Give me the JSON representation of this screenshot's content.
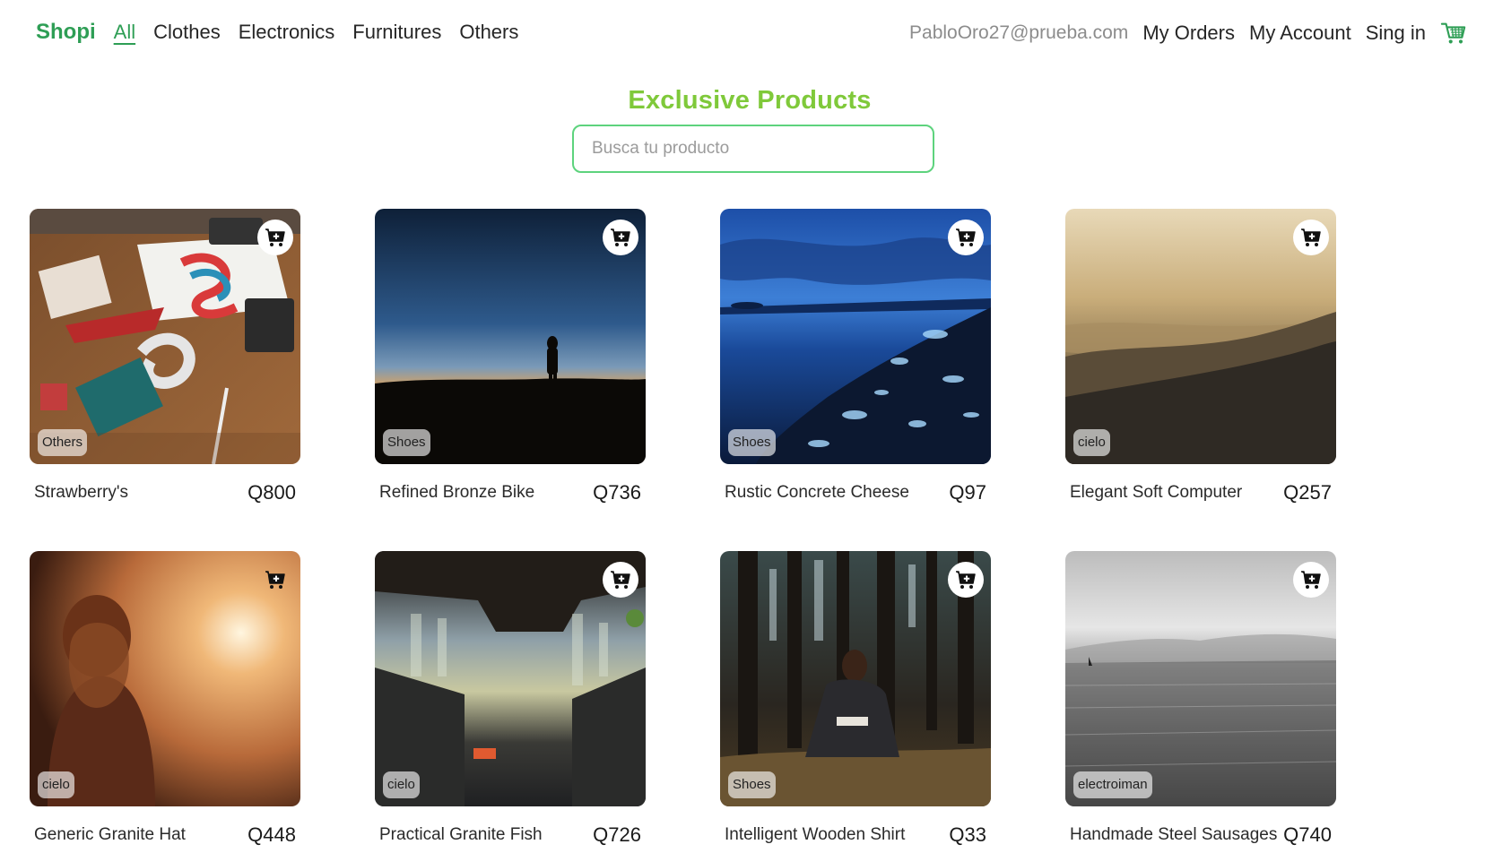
{
  "nav": {
    "brand": "Shopi",
    "categories": [
      "All",
      "Clothes",
      "Electronics",
      "Furnitures",
      "Others"
    ],
    "email": "PabloOro27@prueba.com",
    "my_orders": "My Orders",
    "my_account": "My Account",
    "sign_in": "Sing in",
    "cart_icon": "shopping-cart-icon"
  },
  "page": {
    "title": "Exclusive Products",
    "search_placeholder": "Busca tu producto",
    "search_value": ""
  },
  "colors": {
    "brand": "#2e9e55",
    "title": "#7fc93a",
    "search_border": "#5dd37d"
  },
  "products": [
    {
      "name": "Strawberry's",
      "price": "Q800",
      "category": "Others",
      "image": "desk-flatlay-photo",
      "add_icon": "add-to-cart-icon"
    },
    {
      "name": "Refined Bronze Bike",
      "price": "Q736",
      "category": "Shoes",
      "image": "sunset-silhouette-photo",
      "add_icon": "add-to-cart-icon"
    },
    {
      "name": "Rustic Concrete Cheese",
      "price": "Q97",
      "category": "Shoes",
      "image": "icy-shore-blue-hour-photo",
      "add_icon": "add-to-cart-icon"
    },
    {
      "name": "Elegant Soft Computer",
      "price": "Q257",
      "category": "cielo",
      "image": "misty-forest-hills-photo",
      "add_icon": "add-to-cart-icon"
    },
    {
      "name": "Generic Granite Hat",
      "price": "Q448",
      "category": "cielo",
      "image": "woman-at-sunset-photo",
      "add_icon": "add-to-cart-icon"
    },
    {
      "name": "Practical Granite Fish",
      "price": "Q726",
      "category": "cielo",
      "image": "truck-underside-bokeh-photo",
      "add_icon": "add-to-cart-icon"
    },
    {
      "name": "Intelligent Wooden Shirt",
      "price": "Q33",
      "category": "Shoes",
      "image": "woman-in-forest-photo",
      "add_icon": "add-to-cart-icon"
    },
    {
      "name": "Handmade Steel Sausages",
      "price": "Q740",
      "category": "electroiman",
      "image": "monochrome-lake-photo",
      "add_icon": "add-to-cart-icon"
    }
  ]
}
